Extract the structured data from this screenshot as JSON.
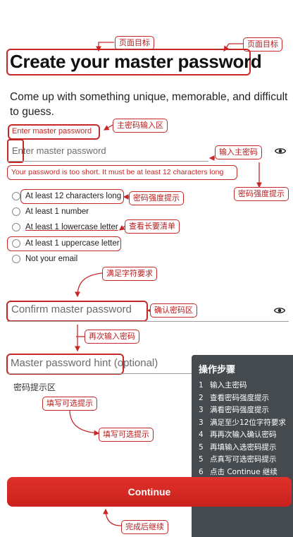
{
  "annotations": {
    "page_goal": "页面目标",
    "master_input_area": "主密码输入区",
    "enter_master": "输入主密码",
    "strength_tip_right": "密码强度提示",
    "strength_tip": "密码强度提示",
    "view_checklist": "查看长要清单",
    "meet_requirements": "满足字符要求",
    "confirm_area": "确认密码区",
    "reenter": "再次输入密码",
    "hint_area": "密码提示区",
    "fill_optional_1": "填写可选提示",
    "fill_optional_2": "填写可选提示",
    "continue_after": "完成后继续"
  },
  "title": "Create your master password",
  "subtitle": "Come up with something unique, memorable, and difficult to guess.",
  "master": {
    "label": "Enter master password",
    "placeholder": "Enter master password",
    "error": "Your password is too short. It must be at least 12 characters long"
  },
  "requirements": [
    "At least 12 characters long",
    "At least 1 number",
    "At least 1 lowercase letter",
    "At least 1 uppercase letter",
    "Not your email"
  ],
  "confirm": {
    "placeholder": "Confirm master password"
  },
  "hint": {
    "placeholder": "Master password hint (optional)"
  },
  "steps_panel": {
    "title": "操作步骤",
    "steps": [
      {
        "n": "1",
        "text": "输入主密码"
      },
      {
        "n": "2",
        "text": "查看密码强度提示"
      },
      {
        "n": "3",
        "text": "满看密码强度提示"
      },
      {
        "n": "3",
        "text": "满足至少12位字符要求"
      },
      {
        "n": "4",
        "text": "再再次输入确认密码"
      },
      {
        "n": "5",
        "text": "再填输入选密码提示"
      },
      {
        "n": "5",
        "text": "点真写可选密码提示"
      },
      {
        "n": "6",
        "text": "点击 Continue 继续"
      }
    ]
  },
  "continue_label": "Continue",
  "colors": {
    "accent": "#d32620",
    "annotation": "#c62828",
    "panel": "#373c42"
  }
}
